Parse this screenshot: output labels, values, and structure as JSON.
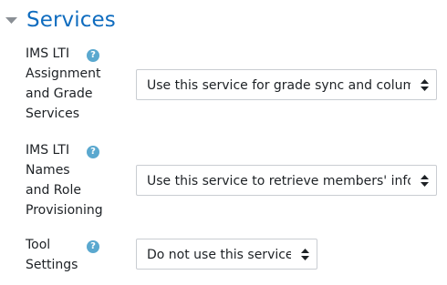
{
  "section": {
    "title": "Services",
    "expanded": true
  },
  "settings": [
    {
      "label_lines": [
        "IMS LTI",
        "Assignment",
        "and Grade",
        "Services"
      ],
      "help_icon": "question-circle-icon",
      "select_value": "Use this service for grade sync and column management"
    },
    {
      "label_lines": [
        "IMS LTI",
        "Names",
        "and Role",
        "Provisioning"
      ],
      "help_icon": "question-circle-icon",
      "select_value": "Use this service to retrieve members' information"
    },
    {
      "label_lines": [
        "Tool",
        "Settings"
      ],
      "help_icon": "question-circle-icon",
      "select_value": "Do not use this service"
    }
  ],
  "colors": {
    "title": "#0f6cbf",
    "help_icon": "#5aa8cf",
    "select_border": "#c9cdd2",
    "text": "#1d2125"
  }
}
